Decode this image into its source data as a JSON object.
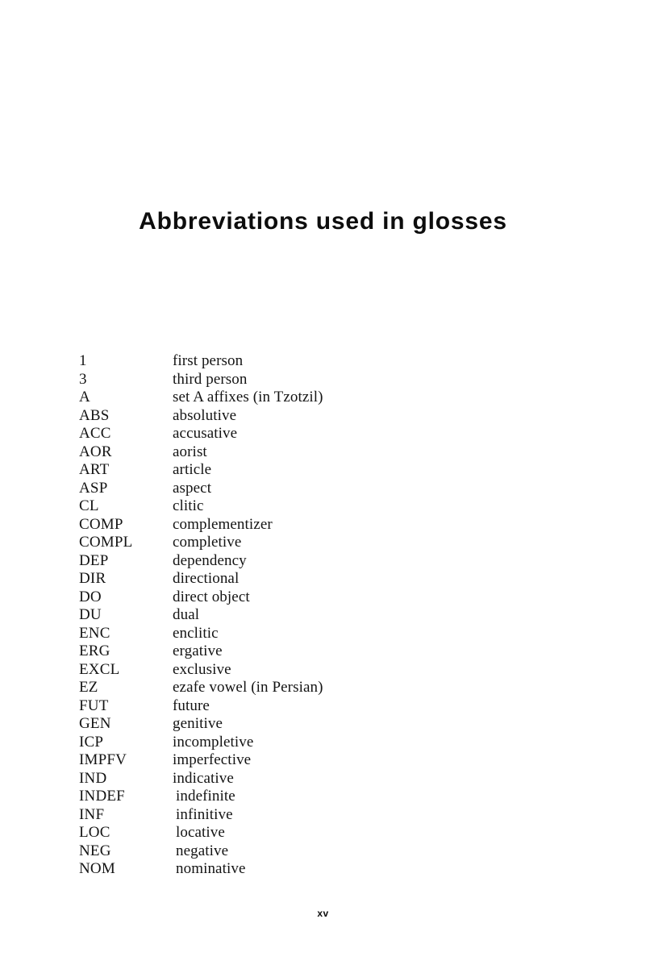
{
  "document": {
    "title": "Abbreviations used in glosses",
    "folio": "xv"
  },
  "abbreviations": [
    {
      "term": "1",
      "gloss": "first person"
    },
    {
      "term": "3",
      "gloss": "third person"
    },
    {
      "term": "A",
      "gloss": "set A affixes (in Tzotzil)"
    },
    {
      "term": "ABS",
      "gloss": "absolutive"
    },
    {
      "term": "ACC",
      "gloss": "accusative"
    },
    {
      "term": "AOR",
      "gloss": "aorist"
    },
    {
      "term": "ART",
      "gloss": "article"
    },
    {
      "term": "ASP",
      "gloss": "aspect"
    },
    {
      "term": "CL",
      "gloss": "clitic"
    },
    {
      "term": "COMP",
      "gloss": "complementizer"
    },
    {
      "term": "COMPL",
      "gloss": "completive"
    },
    {
      "term": "DEP",
      "gloss": "dependency"
    },
    {
      "term": "DIR",
      "gloss": "directional"
    },
    {
      "term": "DO",
      "gloss": "direct object"
    },
    {
      "term": "DU",
      "gloss": "dual"
    },
    {
      "term": "ENC",
      "gloss": "enclitic"
    },
    {
      "term": "ERG",
      "gloss": "ergative"
    },
    {
      "term": "EXCL",
      "gloss": "exclusive"
    },
    {
      "term": "EZ",
      "gloss": "ezafe vowel (in Persian)"
    },
    {
      "term": "FUT",
      "gloss": "future"
    },
    {
      "term": "GEN",
      "gloss": "genitive"
    },
    {
      "term": "ICP",
      "gloss": "incompletive"
    },
    {
      "term": "IMPFV",
      "gloss": "imperfective"
    },
    {
      "term": "IND",
      "gloss": "indicative"
    },
    {
      "term": "INDEF",
      "gloss": "indefinite"
    },
    {
      "term": "INF",
      "gloss": "infinitive"
    },
    {
      "term": "LOC",
      "gloss": "locative"
    },
    {
      "term": "NEG",
      "gloss": "negative"
    },
    {
      "term": "NOM",
      "gloss": "nominative"
    }
  ]
}
